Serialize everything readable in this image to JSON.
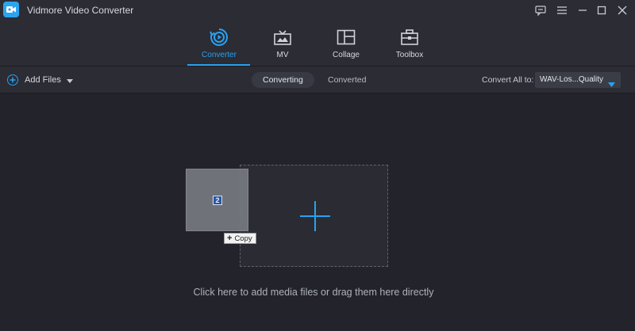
{
  "window": {
    "title": "Vidmore Video Converter",
    "controls": [
      "feedback-icon",
      "menu-icon",
      "minimize-icon",
      "maximize-icon",
      "close-icon"
    ]
  },
  "nav": {
    "tabs": [
      {
        "label": "Converter",
        "icon": "converter-icon",
        "active": true
      },
      {
        "label": "MV",
        "icon": "mv-icon",
        "active": false
      },
      {
        "label": "Collage",
        "icon": "collage-icon",
        "active": false
      },
      {
        "label": "Toolbox",
        "icon": "toolbox-icon",
        "active": false
      }
    ]
  },
  "toolbar": {
    "add_files_label": "Add Files",
    "segments": [
      {
        "label": "Converting",
        "active": true
      },
      {
        "label": "Converted",
        "active": false
      }
    ],
    "convert_all_label": "Convert All to:",
    "format_value": "WAV-Los...Quality"
  },
  "drop_area": {
    "drag_count": "2",
    "copy_label": "Copy",
    "hint": "Click here to add media files or drag them here directly"
  },
  "colors": {
    "accent": "#27a2f2",
    "background": "#22232b",
    "panel": "#2b2c34"
  }
}
